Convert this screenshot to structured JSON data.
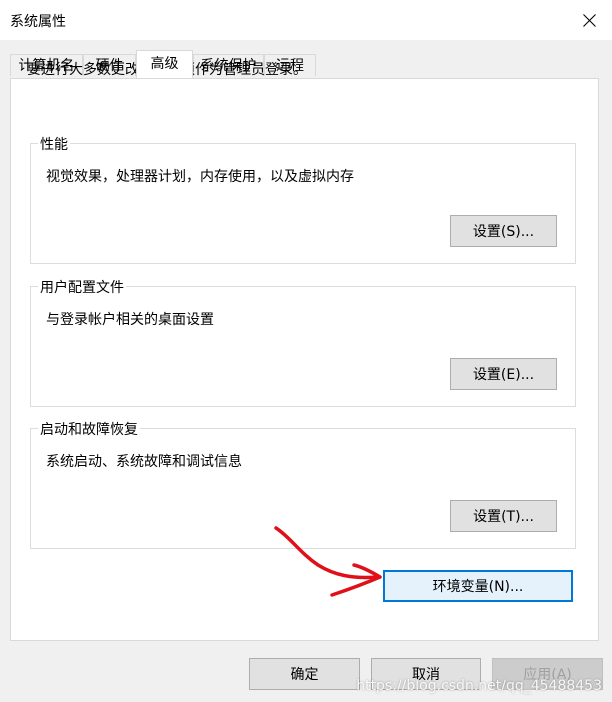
{
  "window": {
    "title": "系统属性",
    "close_icon": "close-icon"
  },
  "tabs": [
    {
      "label": "计算机名",
      "active": false
    },
    {
      "label": "硬件",
      "active": false
    },
    {
      "label": "高级",
      "active": true
    },
    {
      "label": "系统保护",
      "active": false
    },
    {
      "label": "远程",
      "active": false
    }
  ],
  "notice": "要进行大多数更改，你必须作为管理员登录。",
  "groups": {
    "performance": {
      "title": "性能",
      "description": "视觉效果，处理器计划，内存使用，以及虚拟内存",
      "button": "设置(S)..."
    },
    "user_profiles": {
      "title": "用户配置文件",
      "description": "与登录帐户相关的桌面设置",
      "button": "设置(E)..."
    },
    "startup_recovery": {
      "title": "启动和故障恢复",
      "description": "系统启动、系统故障和调试信息",
      "button": "设置(T)..."
    }
  },
  "env_button": "环境变量(N)...",
  "footer": {
    "ok": "确定",
    "cancel": "取消",
    "apply": "应用(A)"
  },
  "colors": {
    "focus_border": "#0078d7",
    "annotation_arrow": "#e0101a"
  },
  "watermark": "https://blog.csdn.net/qq_45488453"
}
